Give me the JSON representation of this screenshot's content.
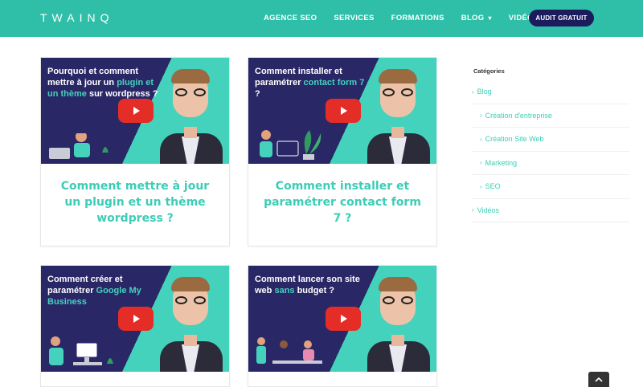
{
  "header": {
    "logo": "TWAINQ",
    "nav": [
      {
        "label": "AGENCE SEO"
      },
      {
        "label": "SERVICES"
      },
      {
        "label": "FORMATIONS"
      },
      {
        "label": "BLOG",
        "has_dropdown": true
      },
      {
        "label": "VIDÉOS"
      }
    ],
    "cta_label": "AUDIT GRATUIT",
    "colors": {
      "bar": "#2fbfa8",
      "cta": "#1b1b5e"
    }
  },
  "posts": [
    {
      "thumb_title_pre": "Pourquoi et comment mettre à jour un ",
      "thumb_title_hl": "plugin et un thème",
      "thumb_title_post": " sur wordpress ?",
      "title": "Comment mettre à jour un plugin et un thème wordpress ?"
    },
    {
      "thumb_title_pre": "Comment installer et paramétrer ",
      "thumb_title_hl": "contact form 7",
      "thumb_title_post": " ?",
      "title": "Comment installer et paramétrer contact form 7 ?"
    },
    {
      "thumb_title_pre": "Comment créer et paramétrer ",
      "thumb_title_hl": "Google My Business",
      "thumb_title_post": "",
      "title": ""
    },
    {
      "thumb_title_pre": "Comment lancer son site web ",
      "thumb_title_hl": "sans",
      "thumb_title_post": " budget ?",
      "title": ""
    }
  ],
  "sidebar": {
    "title": "Catégories",
    "items": [
      {
        "label": "Blog",
        "level": 0
      },
      {
        "label": "Création d'entreprise",
        "level": 1
      },
      {
        "label": "Création Site Web",
        "level": 1
      },
      {
        "label": "Marketing",
        "level": 1
      },
      {
        "label": "SEO",
        "level": 1
      },
      {
        "label": "Vidéos",
        "level": 0
      }
    ]
  },
  "colors": {
    "accent": "#3ccdb7",
    "thumb_dark": "#2a2766",
    "youtube": "#e52d27"
  },
  "icons": {
    "play": "play-icon",
    "chevron": "chevron-right-icon",
    "to_top": "chevron-up-icon"
  }
}
